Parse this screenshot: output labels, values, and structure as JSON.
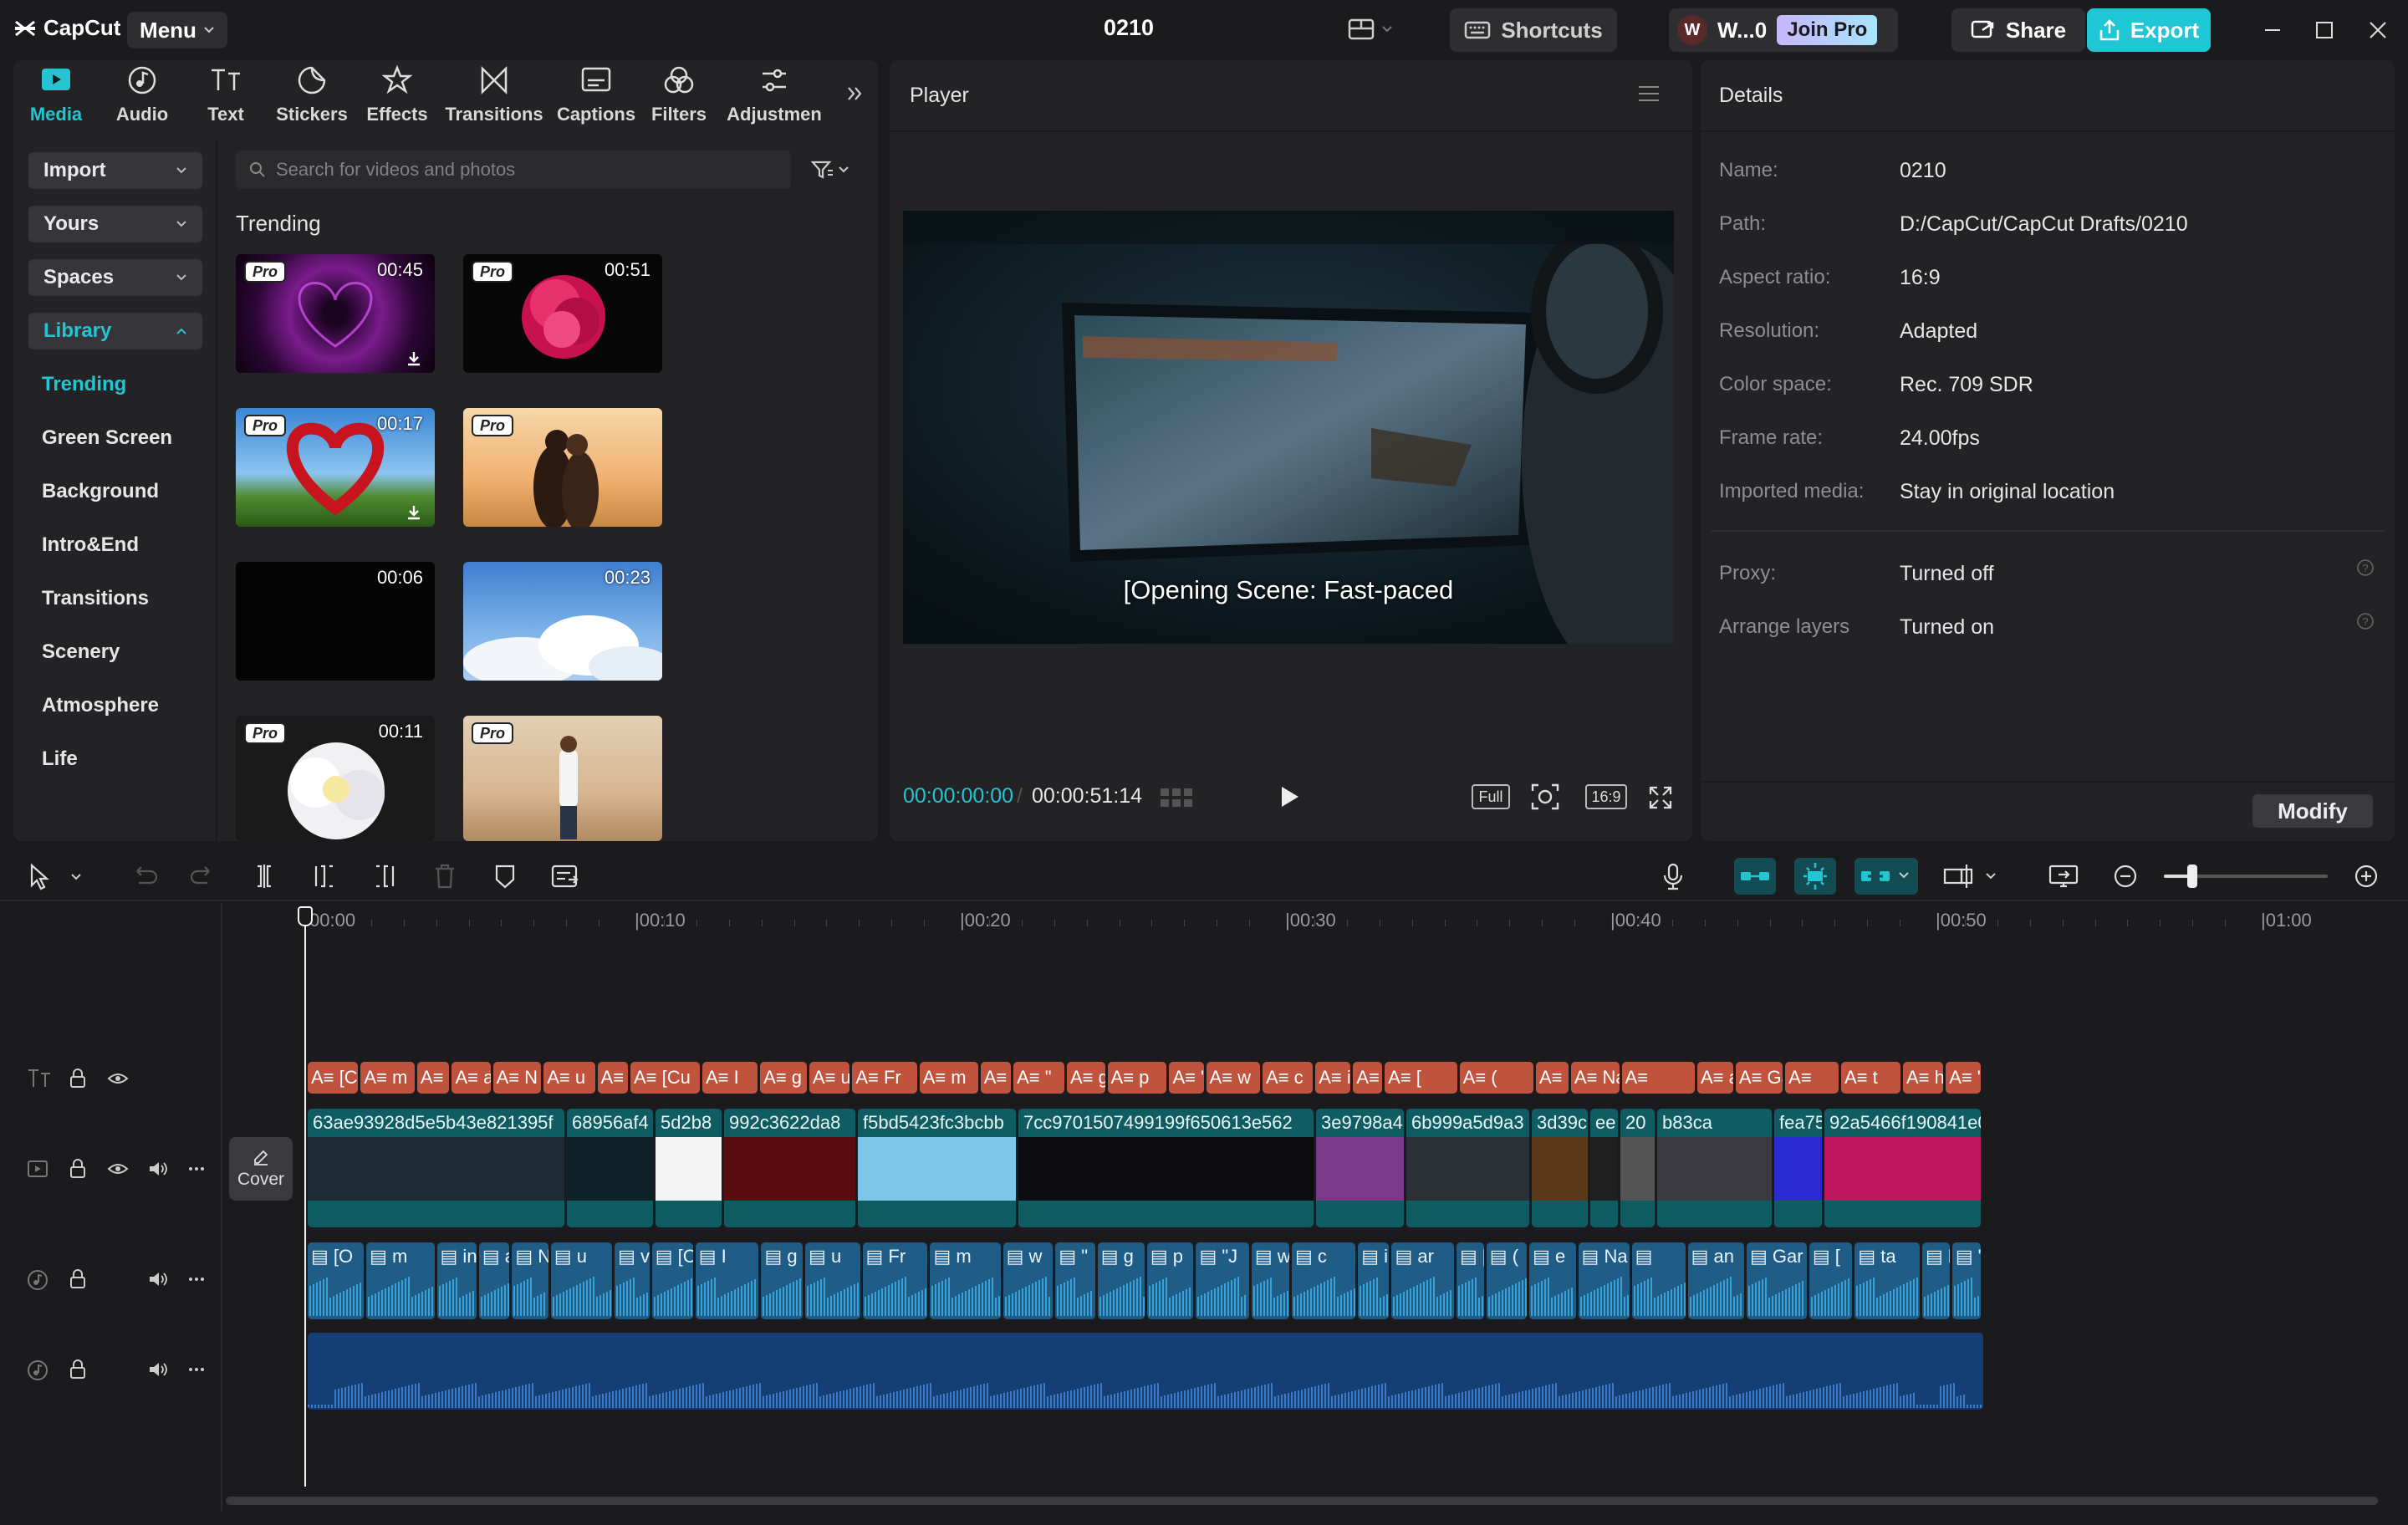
{
  "app": {
    "logo_text": "CapCut",
    "menu_label": "Menu",
    "project_title": "0210",
    "shortcuts_label": "Shortcuts",
    "workspace_initial": "W",
    "workspace_label": "W...0",
    "join_pro_label": "Join Pro",
    "share_label": "Share",
    "export_label": "Export"
  },
  "toolbar": {
    "tabs": [
      {
        "label": "Media",
        "icon": "media-icon",
        "active": true
      },
      {
        "label": "Audio",
        "icon": "audio-icon"
      },
      {
        "label": "Text",
        "icon": "text-icon"
      },
      {
        "label": "Stickers",
        "icon": "stickers-icon"
      },
      {
        "label": "Effects",
        "icon": "effects-icon"
      },
      {
        "label": "Transitions",
        "icon": "transitions-icon"
      },
      {
        "label": "Captions",
        "icon": "captions-icon"
      },
      {
        "label": "Filters",
        "icon": "filters-icon"
      },
      {
        "label": "Adjustmen",
        "icon": "adjustment-icon"
      }
    ]
  },
  "library": {
    "buttons": [
      {
        "label": "Import"
      },
      {
        "label": "Yours"
      },
      {
        "label": "Spaces"
      },
      {
        "label": "Library",
        "active": true
      }
    ],
    "items": [
      "Trending",
      "Green Screen",
      "Background",
      "Intro&End",
      "Transitions",
      "Scenery",
      "Atmosphere",
      "Life"
    ],
    "active_item": "Trending"
  },
  "media": {
    "search_placeholder": "Search for videos and photos",
    "section_title": "Trending",
    "pro_badge": "Pro",
    "thumbs": [
      {
        "duration": "00:45",
        "pro": true,
        "download": true
      },
      {
        "duration": "00:51",
        "pro": true
      },
      {
        "duration": "00:17",
        "pro": true,
        "download": true
      },
      {
        "duration": "",
        "pro": true
      },
      {
        "duration": "00:06",
        "pro": false
      },
      {
        "duration": "00:23",
        "pro": false
      },
      {
        "duration": "00:11",
        "pro": true
      },
      {
        "duration": "",
        "pro": true
      }
    ]
  },
  "player": {
    "title": "Player",
    "subtitle": "[Opening Scene: Fast-paced",
    "current_time": "00:00:00:00",
    "separator": "/",
    "total_time": "00:00:51:14",
    "full_label": "Full",
    "ratio_label": "16:9"
  },
  "details": {
    "title": "Details",
    "rows": [
      {
        "label": "Name:",
        "value": "0210"
      },
      {
        "label": "Path:",
        "value": "D:/CapCut/CapCut Drafts/0210"
      },
      {
        "label": "Aspect ratio:",
        "value": "16:9"
      },
      {
        "label": "Resolution:",
        "value": "Adapted"
      },
      {
        "label": "Color space:",
        "value": "Rec. 709 SDR"
      },
      {
        "label": "Frame rate:",
        "value": "24.00fps"
      },
      {
        "label": "Imported media:",
        "value": "Stay in original location"
      },
      {
        "label": "Proxy:",
        "value": "Turned off"
      },
      {
        "label": "Arrange layers",
        "value": "Turned on"
      }
    ],
    "modify_label": "Modify"
  },
  "timeline": {
    "ruler": [
      "00:00",
      "|00:10",
      "|00:20",
      "|00:30",
      "|00:40",
      "|00:50",
      "|01:00"
    ],
    "cover_label": "Cover",
    "text_clips": [
      "[C",
      "m",
      "in",
      "ar",
      "N",
      "u",
      "v",
      "[Cu",
      "I",
      "g",
      "u",
      "Fr",
      "m",
      "w",
      "\"",
      "g",
      "p",
      "\"",
      "w",
      "c",
      "ir",
      "a",
      "[",
      "(",
      "(",
      "Na",
      "",
      "an",
      "Ga",
      "",
      "t",
      "h",
      "\""
    ],
    "video_clips": [
      "63ae93928d5e5b43e821395f",
      "68956af4",
      "5d2b8",
      "992c3622da8",
      "f5bd5423fc3bcbb",
      "7cc9701507499199f650613e562",
      "3e9798a4",
      "6b999a5d9a3",
      "3d39c",
      "ee",
      "20",
      "b83ca",
      "fea75",
      "92a5466f190841e0c"
    ],
    "audio_clips": [
      "[O",
      "m",
      "in",
      "ar",
      "N",
      "u",
      "v",
      "[Cut",
      "I",
      "g",
      "u",
      "Fr",
      "m",
      "w",
      "\"",
      "g",
      "p",
      "\"J",
      "w",
      "c",
      "in",
      "ar",
      "[",
      "(",
      "e",
      "Na",
      "",
      "an",
      "Gar",
      "[",
      "ta",
      "h",
      "\""
    ],
    "colors": {
      "accent": "#24c5d1",
      "text_clip": "#c0533e",
      "video_clip": "#0f5c62",
      "audio_clip": "#1f5d86",
      "music_clip": "#153f73"
    }
  }
}
